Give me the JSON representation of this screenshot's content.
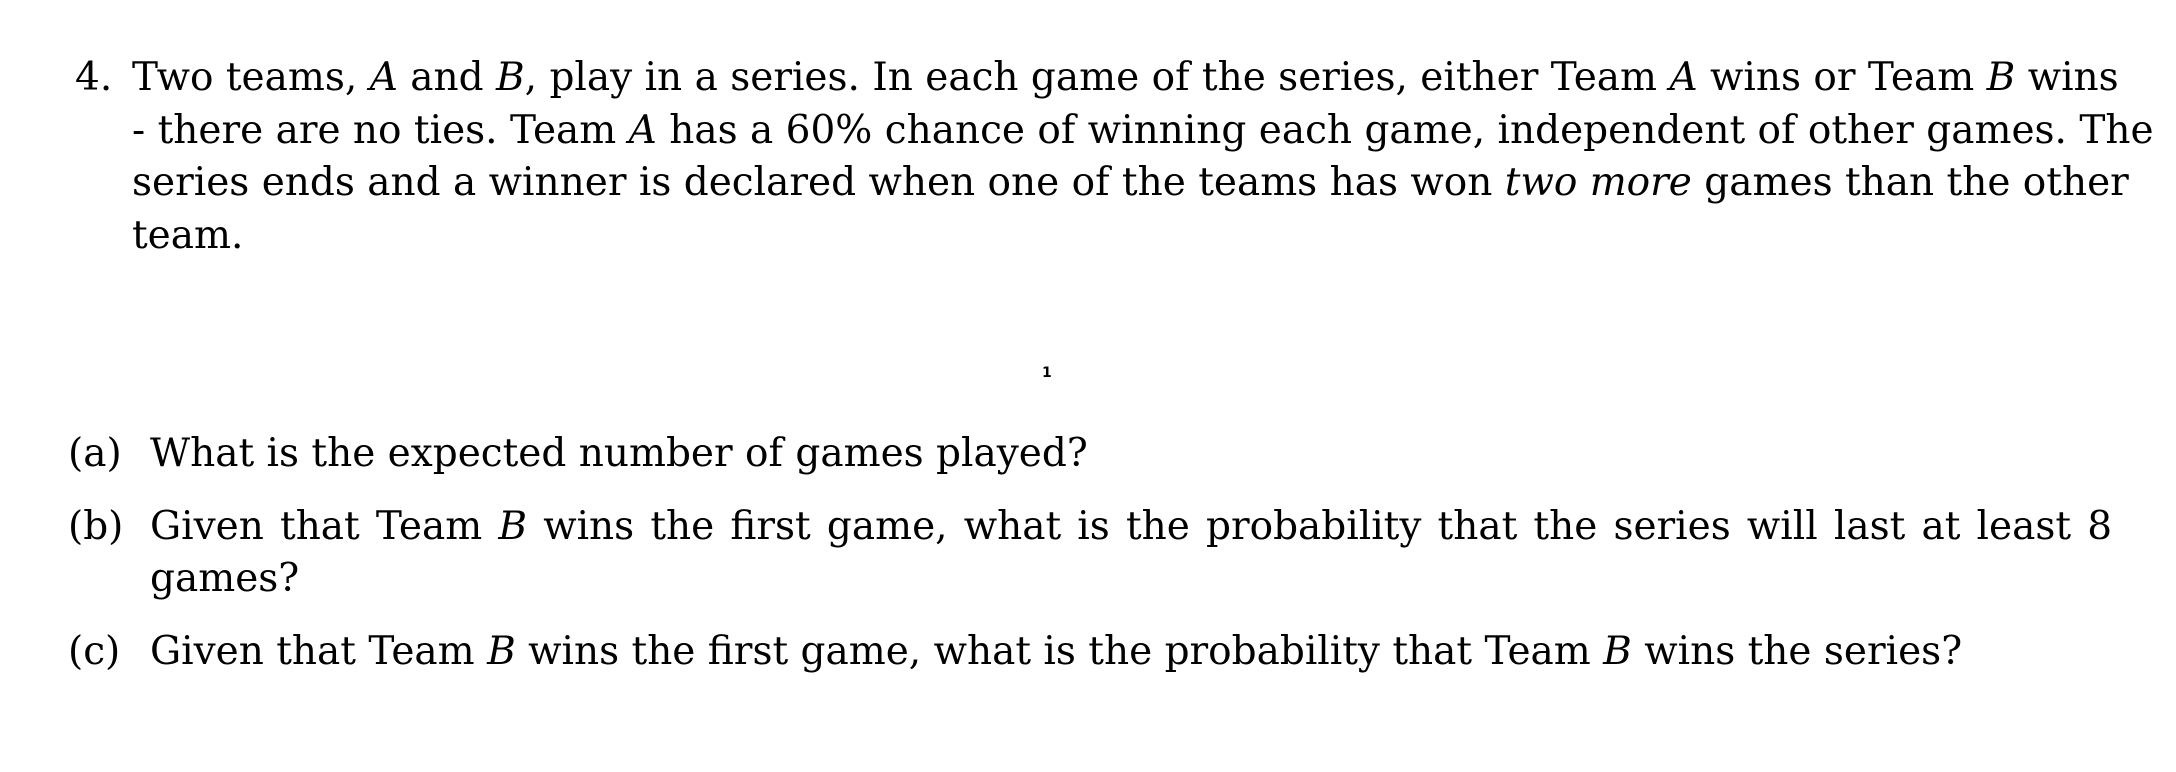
{
  "problem": {
    "number": "4.",
    "stem_lines": [
      {
        "segments": [
          {
            "text": "Two teams, ",
            "style": "normal"
          },
          {
            "text": "A",
            "style": "math"
          },
          {
            "text": " and ",
            "style": "normal"
          },
          {
            "text": "B",
            "style": "math"
          },
          {
            "text": ", play in a series. In each game of the series, either Team ",
            "style": "normal"
          },
          {
            "text": "A",
            "style": "math"
          },
          {
            "text": " wins or Team ",
            "style": "normal"
          },
          {
            "text": "B",
            "style": "math"
          },
          {
            "text": " wins",
            "style": "normal"
          }
        ]
      },
      {
        "segments": [
          {
            "text": "- there are no ties. Team ",
            "style": "normal"
          },
          {
            "text": "A",
            "style": "math"
          },
          {
            "text": " has a 60% chance of winning each game, independent of other games. The",
            "style": "normal"
          }
        ]
      },
      {
        "segments": [
          {
            "text": "series ends and a winner is declared when one of the teams has won ",
            "style": "normal"
          },
          {
            "text": "two more",
            "style": "emph"
          },
          {
            "text": " games than the other",
            "style": "normal"
          }
        ]
      },
      {
        "segments": [
          {
            "text": "team.",
            "style": "normal"
          }
        ]
      }
    ]
  },
  "page_number": "1",
  "parts": [
    {
      "label": "(a)",
      "lines": [
        {
          "segments": [
            {
              "text": "What is the expected number of games played?",
              "style": "normal"
            }
          ]
        }
      ]
    },
    {
      "label": "(b)",
      "lines": [
        {
          "segments": [
            {
              "text": "Given that Team ",
              "style": "normal"
            },
            {
              "text": "B",
              "style": "math"
            },
            {
              "text": " wins the first game, what is the probability that the series will last at least 8",
              "style": "normal"
            }
          ]
        },
        {
          "segments": [
            {
              "text": "games?",
              "style": "normal"
            }
          ]
        }
      ]
    },
    {
      "label": "(c)",
      "lines": [
        {
          "segments": [
            {
              "text": "Given that Team ",
              "style": "normal"
            },
            {
              "text": "B",
              "style": "math"
            },
            {
              "text": " wins the first game, what is the probability that Team ",
              "style": "normal"
            },
            {
              "text": "B",
              "style": "math"
            },
            {
              "text": " wins the series?",
              "style": "normal"
            }
          ]
        }
      ]
    }
  ]
}
